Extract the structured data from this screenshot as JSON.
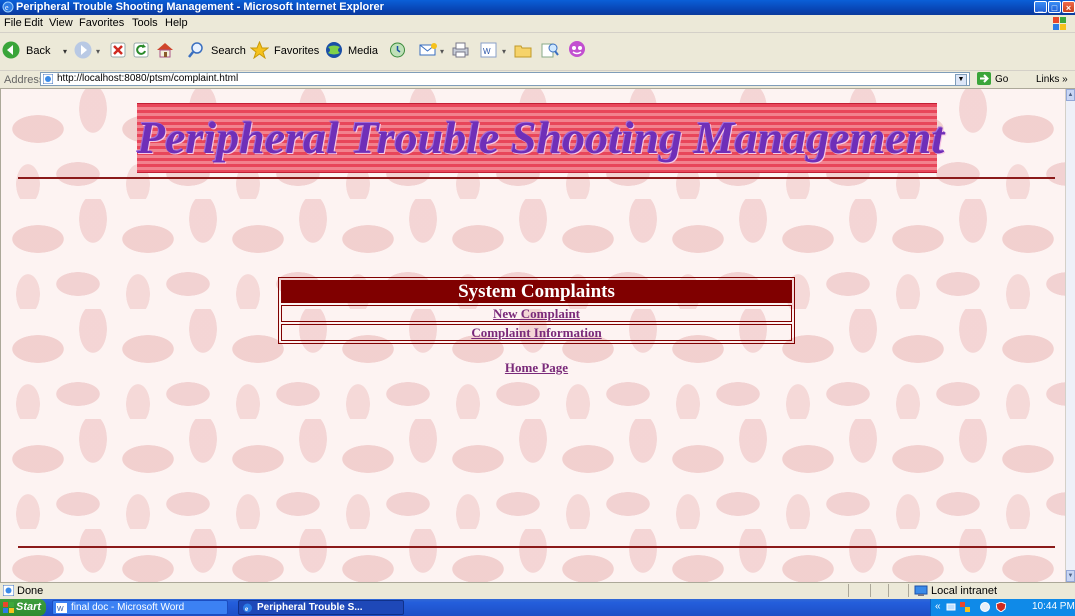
{
  "window": {
    "title": "Peripheral Trouble Shooting Management - Microsoft Internet Explorer",
    "controls": [
      "_",
      "□",
      "×"
    ]
  },
  "menubar": [
    "File",
    "Edit",
    "View",
    "Favorites",
    "Tools",
    "Help"
  ],
  "toolbar": {
    "back": "Back",
    "search": "Search",
    "favorites": "Favorites",
    "media": "Media"
  },
  "address": {
    "label": "Address",
    "url": "http://localhost:8080/ptsm/complaint.html",
    "go": "Go",
    "links": "Links »"
  },
  "page": {
    "banner": "Peripheral Trouble Shooting Management",
    "menu_title": "System Complaints",
    "items": [
      "New Complaint",
      "Complaint Information"
    ],
    "home_link": "Home Page"
  },
  "status": {
    "text": "Done",
    "zone": "Local intranet"
  },
  "taskbar": {
    "start": "Start",
    "tasks": [
      "final doc - Microsoft Word",
      "Peripheral Trouble S..."
    ],
    "tray_chevron": "«",
    "clock": "10:44 PM"
  },
  "colors": {
    "title_bar": "#0842b0",
    "banner_text": "#6f2fb8",
    "menu_header": "#800000",
    "link": "#7a2a7a"
  }
}
